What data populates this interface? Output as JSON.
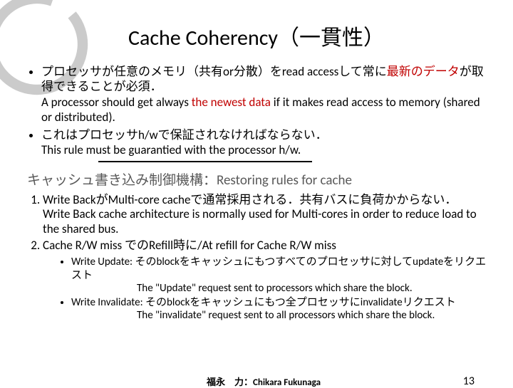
{
  "title": "Cache Coherency（一貫性）",
  "bullets": {
    "b1_jp_pre": "プロセッサが任意のメモリ（共有or分散）をread accessして常に",
    "b1_jp_red": "最新のデータ",
    "b1_jp_post": "が取得できることが必須．",
    "b1_en_pre": "A processor should get always ",
    "b1_en_red": "the newest data",
    "b1_en_post": " if it makes read access to memory (shared or distributed).",
    "b2_jp": "これはプロセッサh/wで保証されなければならない．",
    "b2_en": "This rule must be guarantied with the processor h/w."
  },
  "subtitle": "キャッシュ書き込み制御機構：Restoring rules for cache",
  "rules": {
    "r1_jp": "Write BackがMulti-core cacheで通常採用される．共有バスに負荷かからない．",
    "r1_en": "Write Back cache architecture is normally used for Multi-cores in order to reduce load to the shared bus.",
    "r2": "Cache R/W miss でのRefill時に/At refill for Cache R/W miss",
    "wu_label": "Write Update: ",
    "wu_jp": "そのblockをキャッシュにもつすべてのプロセッサに対してupdateをリクエスト",
    "wu_en": "The \"Update\" request sent to processors which share the block.",
    "wi_label": "Write Invalidate: ",
    "wi_jp": "そのblockをキャッシュにもつ全プロセッサにinvalidateリクエスト",
    "wi_en": "The \"invalidate\" request sent to all processors which share the block."
  },
  "footer": {
    "author": "福永　力：Chikara Fukunaga",
    "page": "13"
  }
}
